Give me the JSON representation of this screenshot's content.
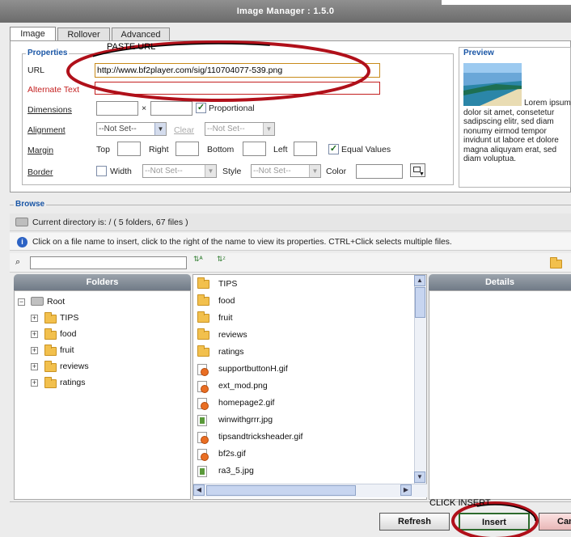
{
  "window": {
    "title": "Image Manager : 1.5.0"
  },
  "tabs": [
    "Image",
    "Rollover",
    "Advanced"
  ],
  "properties": {
    "legend": "Properties",
    "url_label": "URL",
    "url_value": "http://www.bf2player.com/sig/110704077-539.png",
    "alt_label": "Alternate Text",
    "alt_value": "",
    "dimensions_label": "Dimensions",
    "dimensions_sep": "×",
    "proportional_label": "Proportional",
    "proportional_checked": true,
    "alignment_label": "Alignment",
    "alignment_value": "--Not Set--",
    "clear_label": "Clear",
    "clear_value": "--Not Set--",
    "margin_label": "Margin",
    "top_label": "Top",
    "right_label": "Right",
    "bottom_label": "Bottom",
    "left_label": "Left",
    "equal_values_label": "Equal Values",
    "equal_values_checked": true,
    "border_label": "Border",
    "width_label": "Width",
    "width_value": "--Not Set--",
    "style_label": "Style",
    "style_value": "--Not Set--",
    "color_label": "Color"
  },
  "preview": {
    "legend": "Preview",
    "text": "Lorem ipsum dolor sit amet, consetetur sadipscing elitr, sed diam nonumy eirmod tempor invidunt ut labore et dolore magna aliquyam erat, sed diam voluptua."
  },
  "browse": {
    "legend": "Browse",
    "current_dir": "Current directory is: / ( 5 folders, 67 files )",
    "info": "Click on a file name to insert, click to the right of the name to view its properties. CTRL+Click selects multiple files.",
    "folders_header": "Folders",
    "details_header": "Details",
    "tree_root": "Root",
    "tree_folders": [
      "TIPS",
      "food",
      "fruit",
      "reviews",
      "ratings"
    ],
    "files": [
      {
        "name": "TIPS",
        "kind": "folder"
      },
      {
        "name": "food",
        "kind": "folder"
      },
      {
        "name": "fruit",
        "kind": "folder"
      },
      {
        "name": "reviews",
        "kind": "folder"
      },
      {
        "name": "ratings",
        "kind": "folder"
      },
      {
        "name": "supportbuttonH.gif",
        "kind": "gif"
      },
      {
        "name": "ext_mod.png",
        "kind": "png"
      },
      {
        "name": "homepage2.gif",
        "kind": "gif"
      },
      {
        "name": "winwithgrrr.jpg",
        "kind": "jpg"
      },
      {
        "name": "tipsandtricksheader.gif",
        "kind": "gif"
      },
      {
        "name": "bf2s.gif",
        "kind": "gif"
      },
      {
        "name": "ra3_5.jpg",
        "kind": "jpg"
      }
    ]
  },
  "annotations": {
    "paste_url": "PASTE URL",
    "click_insert": "CLICK INSERT"
  },
  "buttons": {
    "refresh": "Refresh",
    "insert": "Insert",
    "cancel": "Can"
  },
  "colors": {
    "annotation_circle": "#b0101a",
    "accent": "#1a56a6"
  }
}
